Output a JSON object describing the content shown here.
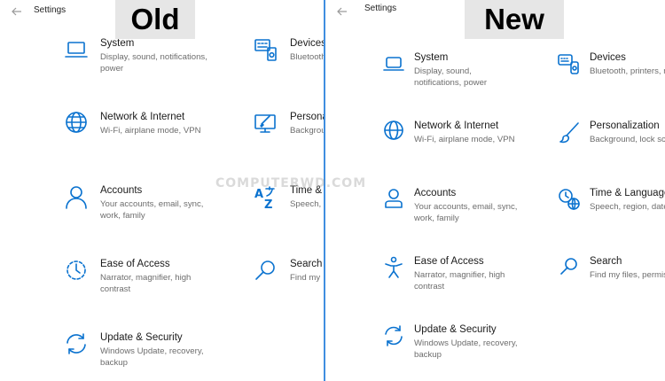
{
  "window": {
    "title": "Settings"
  },
  "labels": {
    "old": "Old",
    "new": "New"
  },
  "watermark": "COMPUTERWD.COM",
  "old_settings": {
    "system": {
      "name": "System",
      "desc": "Display, sound, notifications, power"
    },
    "devices": {
      "name": "Devices",
      "desc": "Bluetooth"
    },
    "network": {
      "name": "Network & Internet",
      "desc": "Wi-Fi, airplane mode, VPN"
    },
    "personalization": {
      "name": "Persona",
      "desc": "Backgrou"
    },
    "accounts": {
      "name": "Accounts",
      "desc": "Your accounts, email, sync, work, family"
    },
    "time": {
      "name": "Time &",
      "desc": "Speech, r"
    },
    "ease": {
      "name": "Ease of Access",
      "desc": "Narrator, magnifier, high contrast"
    },
    "search": {
      "name": "Search",
      "desc": "Find my"
    },
    "update": {
      "name": "Update & Security",
      "desc": "Windows Update, recovery, backup"
    }
  },
  "new_settings": {
    "system": {
      "name": "System",
      "desc": "Display, sound, notifications, power"
    },
    "devices": {
      "name": "Devices",
      "desc": "Bluetooth, printers, mou"
    },
    "network": {
      "name": "Network & Internet",
      "desc": "Wi-Fi, airplane mode, VPN"
    },
    "personalization": {
      "name": "Personalization",
      "desc": "Background, lock scre"
    },
    "accounts": {
      "name": "Accounts",
      "desc": "Your accounts, email, sync, work, family"
    },
    "time": {
      "name": "Time & Language",
      "desc": "Speech, region, date"
    },
    "ease": {
      "name": "Ease of Access",
      "desc": "Narrator, magnifier, high contrast"
    },
    "search": {
      "name": "Search",
      "desc": "Find my files, permiss"
    },
    "update": {
      "name": "Update & Security",
      "desc": "Windows Update, recovery, backup"
    }
  },
  "colors": {
    "accent": "#0a72cf",
    "divider": "#3f8ee0",
    "label_bg": "#e6e6e6"
  }
}
